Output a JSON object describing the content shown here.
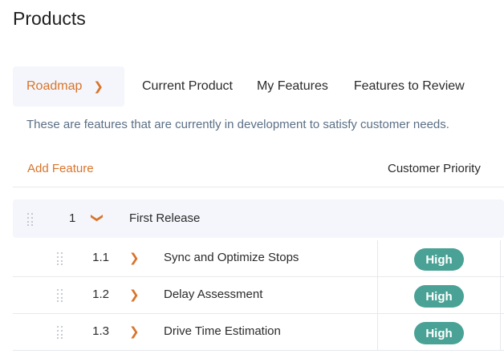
{
  "page": {
    "title": "Products"
  },
  "tabs": [
    {
      "label": "Roadmap",
      "active": true
    },
    {
      "label": "Current Product"
    },
    {
      "label": "My Features"
    },
    {
      "label": "Features to Review"
    }
  ],
  "description": "These are features that are currently in development to satisfy customer needs.",
  "toolbar": {
    "add_feature_label": "Add Feature",
    "priority_header": "Customer Priority"
  },
  "group": {
    "number": "1",
    "name": "First Release"
  },
  "features": [
    {
      "number": "1.1",
      "name": "Sync and Optimize Stops",
      "priority": "High"
    },
    {
      "number": "1.2",
      "name": "Delay Assessment",
      "priority": "High"
    },
    {
      "number": "1.3",
      "name": "Drive Time Estimation",
      "priority": "High"
    }
  ],
  "colors": {
    "accent": "#d9742b",
    "badge": "#4aa296",
    "description": "#5b6f86"
  },
  "icons": {
    "tab_chevron": "chevron-right-icon",
    "group_chevron": "chevron-down-icon",
    "drag": "drag-handle-icon"
  }
}
